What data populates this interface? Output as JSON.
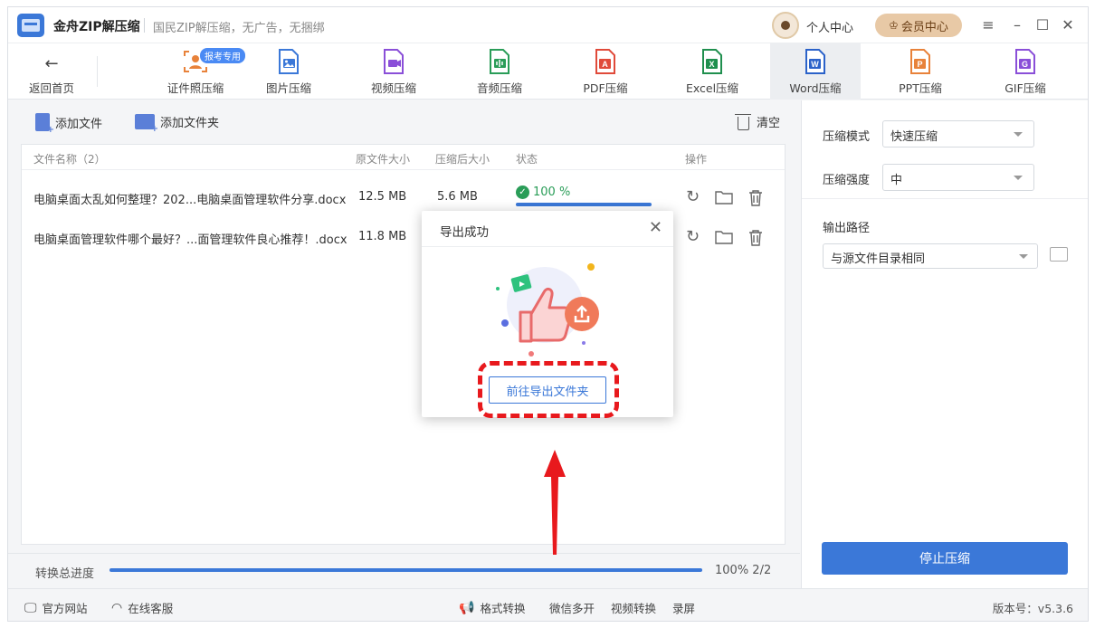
{
  "app": {
    "title": "金舟ZIP解压缩",
    "slogan": "国民ZIP解压缩，无广告，无捆绑",
    "personal_center": "个人中心",
    "vip_center": "会员中心",
    "menu_icon": "≡",
    "minimize_icon": "–",
    "maximize_icon": "☐",
    "close_icon": "✕"
  },
  "toolbar": {
    "back_label": "返回首页",
    "badge": "报考专用",
    "items": [
      {
        "label": "证件照压缩",
        "icon": "id-photo-icon",
        "color": "#e8823a"
      },
      {
        "label": "图片压缩",
        "icon": "image-icon",
        "color": "#3b78d8"
      },
      {
        "label": "视频压缩",
        "icon": "video-icon",
        "color": "#8a4fd8"
      },
      {
        "label": "音频压缩",
        "icon": "audio-icon",
        "color": "#2a9d58"
      },
      {
        "label": "PDF压缩",
        "icon": "pdf-icon",
        "color": "#e04a3a",
        "tag": "A"
      },
      {
        "label": "Excel压缩",
        "icon": "excel-icon",
        "color": "#1f8f4e",
        "tag": "X"
      },
      {
        "label": "Word压缩",
        "icon": "word-icon",
        "color": "#2b62c9",
        "tag": "W",
        "active": true
      },
      {
        "label": "PPT压缩",
        "icon": "ppt-icon",
        "color": "#e8823a",
        "tag": "P"
      },
      {
        "label": "GIF压缩",
        "icon": "gif-icon",
        "color": "#8a4fd8",
        "tag": "G"
      }
    ]
  },
  "file_actions": {
    "add_file": "添加文件",
    "add_folder": "添加文件夹",
    "clear": "清空"
  },
  "table": {
    "headers": {
      "name": "文件名称（2）",
      "original": "原文件大小",
      "compressed": "压缩后大小",
      "status": "状态",
      "actions": "操作"
    },
    "rows": [
      {
        "name": "电脑桌面太乱如何整理？202...电脑桌面管理软件分享.docx",
        "original": "12.5 MB",
        "compressed": "5.6 MB",
        "status": "100 %",
        "progress": 1.0
      },
      {
        "name": "电脑桌面管理软件哪个最好？...面管理软件良心推荐！.docx",
        "original": "11.8 MB",
        "compressed": "",
        "status": "",
        "progress": null
      }
    ]
  },
  "settings": {
    "mode_label": "压缩模式",
    "mode_value": "快速压缩",
    "strength_label": "压缩强度",
    "strength_value": "中",
    "output_label": "输出路径",
    "output_value": "与源文件目录相同",
    "stop_button": "停止压缩"
  },
  "overall": {
    "label": "转换总进度",
    "value": "100% 2/2",
    "progress": 1.0
  },
  "footer": {
    "website": "官方网站",
    "support": "在线客服",
    "links": [
      "格式转换",
      "微信多开",
      "视频转换",
      "录屏"
    ],
    "version": "版本号：v5.3.6"
  },
  "dialog": {
    "title": "导出成功",
    "button": "前往导出文件夹"
  },
  "colors": {
    "accent": "#3b78d8",
    "success": "#2a9d58",
    "highlight": "#e8191d",
    "vip": "#e8c9a6"
  }
}
